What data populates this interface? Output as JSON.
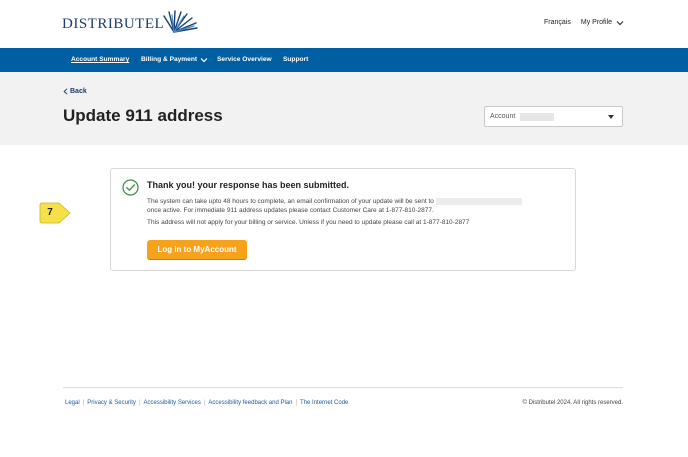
{
  "brand": {
    "logo_text": "DISTRIBUTEL"
  },
  "header": {
    "language_link": "Français",
    "profile_label": "My Profile"
  },
  "nav": {
    "items": [
      {
        "label": "Account Summary"
      },
      {
        "label": "Billing & Payment"
      },
      {
        "label": "Service Overview"
      },
      {
        "label": "Support"
      }
    ]
  },
  "page": {
    "back_label": "Back",
    "title": "Update 911 address",
    "account_label": "Account"
  },
  "confirmation": {
    "heading": "Thank you! your response has been submitted.",
    "line1": "The system can take upto 48 hours to complete, an email confirmation of your update will be sent to",
    "line2": "once active. For immediate 911 address updates please contact Customer Care at 1-877-810-2877.",
    "line3": "This address will not apply for your billing or service. Unless if you need to update please call at 1-877-810-2877",
    "button_label": "Log in to MyAccount"
  },
  "step_badge": {
    "number": "7"
  },
  "footer": {
    "links": [
      "Legal",
      "Privacy & Security",
      "Accessibility Services",
      "Accessibility feedback and Plan",
      "The Internet Code"
    ],
    "copyright": "© Distributel 2024. All rights reserved."
  },
  "colors": {
    "nav_background": "#005fa3",
    "brand_navy": "#1c3d6e",
    "button_orange": "#f7a21b",
    "success_green": "#3a8a3a",
    "badge_yellow": "#f5e04a"
  },
  "icons": [
    "logo-burst-icon",
    "chevron-down-icon",
    "chevron-left-icon",
    "caret-down-icon",
    "check-circle-icon"
  ]
}
